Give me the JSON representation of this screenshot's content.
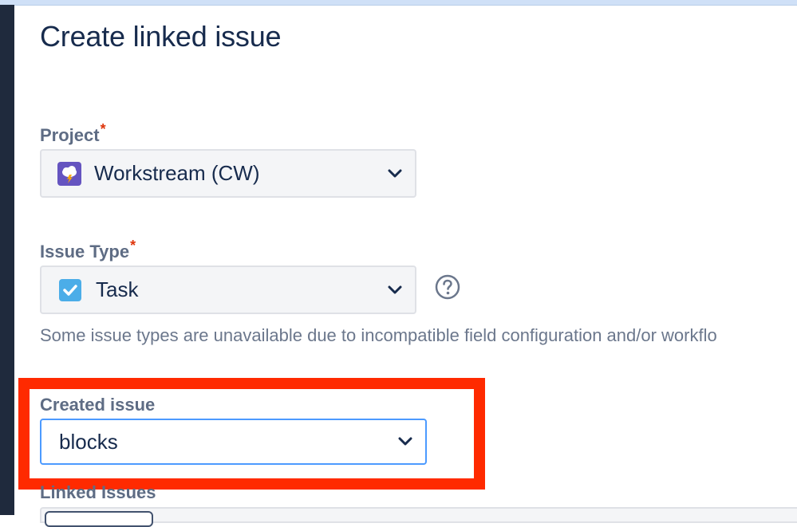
{
  "dialog": {
    "title": "Create linked issue"
  },
  "project": {
    "label": "Project",
    "required_marker": "*",
    "value": "Workstream (CW)",
    "icon": "workstream-project-icon"
  },
  "issue_type": {
    "label": "Issue Type",
    "required_marker": "*",
    "value": "Task",
    "icon": "task-checkbox-icon",
    "help_icon": "question-circle-icon",
    "note": "Some issue types are unavailable due to incompatible field configuration and/or workflo"
  },
  "created_issue": {
    "label": "Created issue",
    "value": "blocks",
    "highlight_color": "#ff2a00"
  },
  "linked_issues": {
    "label": "Linked Issues"
  },
  "colors": {
    "accent": "#4c9aff",
    "required": "#de350b",
    "text": "#172b4d",
    "label": "#5e6c84"
  }
}
